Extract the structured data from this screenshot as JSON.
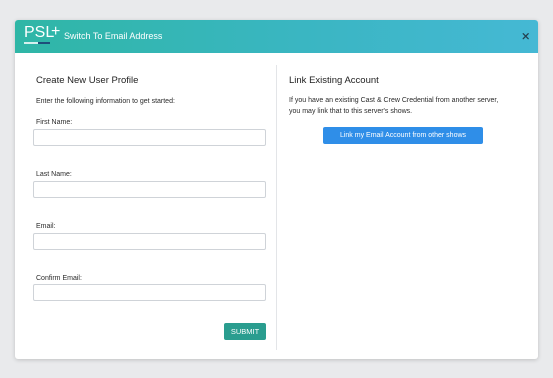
{
  "header": {
    "logo_text": "PSL",
    "logo_plus": "+",
    "title": "Switch To Email Address",
    "close_glyph": "×",
    "accent_gradient": [
      "#2fb6a6",
      "#45b8d4"
    ]
  },
  "create_profile": {
    "title": "Create New User Profile",
    "intro": "Enter the following information to get started:",
    "fields": [
      {
        "label": "First Name:",
        "value": "",
        "placeholder": ""
      },
      {
        "label": "Last Name:",
        "value": "",
        "placeholder": ""
      },
      {
        "label": "Email:",
        "value": "",
        "placeholder": ""
      },
      {
        "label": "Confirm Email:",
        "value": "",
        "placeholder": ""
      }
    ],
    "submit_label": "SUBMIT",
    "submit_color": "#2a9d8f"
  },
  "link_account": {
    "title": "Link Existing Account",
    "description_line1": "If you have an existing Cast & Crew Credential from another server,",
    "description_line2": "you may link that to this server's shows.",
    "button_label": "Link my Email Account from other shows",
    "button_color": "#2f8ee8"
  }
}
